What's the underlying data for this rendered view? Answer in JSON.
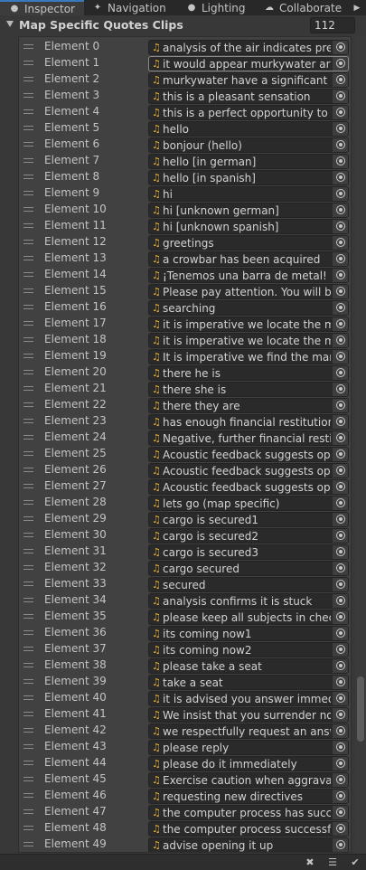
{
  "tabs": [
    {
      "label": "Inspector",
      "icon": "info-icon"
    },
    {
      "label": "Navigation",
      "icon": "navigation-icon"
    },
    {
      "label": "Lighting",
      "icon": "lightbulb-icon"
    },
    {
      "label": "Collaborate",
      "icon": "cloud-icon"
    }
  ],
  "header": {
    "title": "Map Specific Quotes Clips",
    "size": "112"
  },
  "elements": [
    {
      "label": "Element 0",
      "clip": "analysis of the air indicates presence of"
    },
    {
      "label": "Element 1",
      "clip": "it would appear murkywater are in"
    },
    {
      "label": "Element 2",
      "clip": "murkywater have a significant presence"
    },
    {
      "label": "Element 3",
      "clip": "this is a pleasant sensation"
    },
    {
      "label": "Element 4",
      "clip": "this is a perfect opportunity to explore"
    },
    {
      "label": "Element 5",
      "clip": "hello"
    },
    {
      "label": "Element 6",
      "clip": "bonjour (hello)"
    },
    {
      "label": "Element 7",
      "clip": "hello [in german]"
    },
    {
      "label": "Element 8",
      "clip": "hello [in spanish]"
    },
    {
      "label": "Element 9",
      "clip": "hi"
    },
    {
      "label": "Element 10",
      "clip": "hi [unknown german]"
    },
    {
      "label": "Element 11",
      "clip": "hi [unknown spanish]"
    },
    {
      "label": "Element 12",
      "clip": "greetings"
    },
    {
      "label": "Element 13",
      "clip": "a crowbar has been acquired"
    },
    {
      "label": "Element 14",
      "clip": "¡Tenemos una barra de metal! (We have"
    },
    {
      "label": "Element 15",
      "clip": "Please pay attention. You will be loading"
    },
    {
      "label": "Element 16",
      "clip": "searching"
    },
    {
      "label": "Element 17",
      "clip": "it is imperative we locate the manager"
    },
    {
      "label": "Element 18",
      "clip": "it is imperative we locate the manager"
    },
    {
      "label": "Element 19",
      "clip": "It is imperative we find the manager"
    },
    {
      "label": "Element 20",
      "clip": "there he is"
    },
    {
      "label": "Element 21",
      "clip": "there she is"
    },
    {
      "label": "Element 22",
      "clip": "there they are"
    },
    {
      "label": "Element 23",
      "clip": "has enough financial restitution been"
    },
    {
      "label": "Element 24",
      "clip": "Negative, further financial restitution"
    },
    {
      "label": "Element 25",
      "clip": "Acoustic feedback suggests opposition"
    },
    {
      "label": "Element 26",
      "clip": "Acoustic feedback suggests opposition"
    },
    {
      "label": "Element 27",
      "clip": "Acoustic feedback suggests opposition"
    },
    {
      "label": "Element 28",
      "clip": "lets go (map specific)"
    },
    {
      "label": "Element 29",
      "clip": "cargo is secured1"
    },
    {
      "label": "Element 30",
      "clip": "cargo is secured2"
    },
    {
      "label": "Element 31",
      "clip": "cargo is secured3"
    },
    {
      "label": "Element 32",
      "clip": "cargo secured"
    },
    {
      "label": "Element 33",
      "clip": "secured"
    },
    {
      "label": "Element 34",
      "clip": "analysis confirms it is stuck"
    },
    {
      "label": "Element 35",
      "clip": "please keep all subjects in check"
    },
    {
      "label": "Element 36",
      "clip": "its coming now1"
    },
    {
      "label": "Element 37",
      "clip": "its coming now2"
    },
    {
      "label": "Element 38",
      "clip": "please take a seat"
    },
    {
      "label": "Element 39",
      "clip": "take a seat"
    },
    {
      "label": "Element 40",
      "clip": "it is advised you answer immediately"
    },
    {
      "label": "Element 41",
      "clip": "We insist that you surrender notion"
    },
    {
      "label": "Element 42",
      "clip": "we respectfully request an answer"
    },
    {
      "label": "Element 43",
      "clip": "please reply"
    },
    {
      "label": "Element 44",
      "clip": "please do it immediately"
    },
    {
      "label": "Element 45",
      "clip": "Exercise caution when aggravating"
    },
    {
      "label": "Element 46",
      "clip": "requesting new directives"
    },
    {
      "label": "Element 47",
      "clip": "the computer process has successfully"
    },
    {
      "label": "Element 48",
      "clip": "the computer process successfully"
    },
    {
      "label": "Element 49",
      "clip": "advise opening it up"
    }
  ],
  "colors": {
    "accent": "#3a79bb",
    "audio_icon": "#e6b43c",
    "panel_bg": "#383838"
  }
}
